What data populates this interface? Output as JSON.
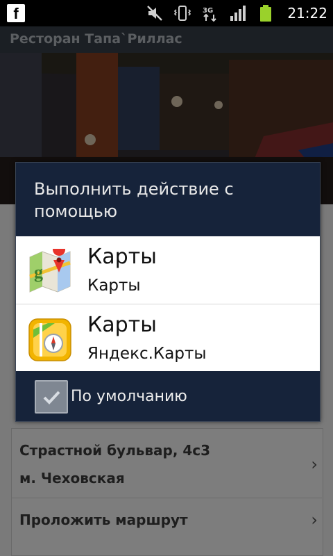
{
  "status_bar": {
    "time": "21:22",
    "icons": [
      "facebook-icon",
      "mute-icon",
      "vibrate-icon",
      "3g-data-icon",
      "signal-icon",
      "battery-icon"
    ]
  },
  "app": {
    "title": "Ресторан Тапа`Риллас"
  },
  "underlay": {
    "address_line1": "Страстной бульвар, 4с3",
    "address_line2": "м. Чеховская",
    "route_label": "Проложить маршрут"
  },
  "dialog": {
    "title": "Выполнить действие с помощью",
    "options": [
      {
        "title": "Карты",
        "subtitle": "Карты",
        "icon": "google-maps-icon"
      },
      {
        "title": "Карты",
        "subtitle": "Яндекс.Карты",
        "icon": "yandex-maps-icon"
      }
    ],
    "default_label": "По умолчанию",
    "default_checked": true
  },
  "colors": {
    "dialog_bg": "#16233a",
    "list_bg": "#ffffff",
    "statusbar_bg": "#000000"
  }
}
